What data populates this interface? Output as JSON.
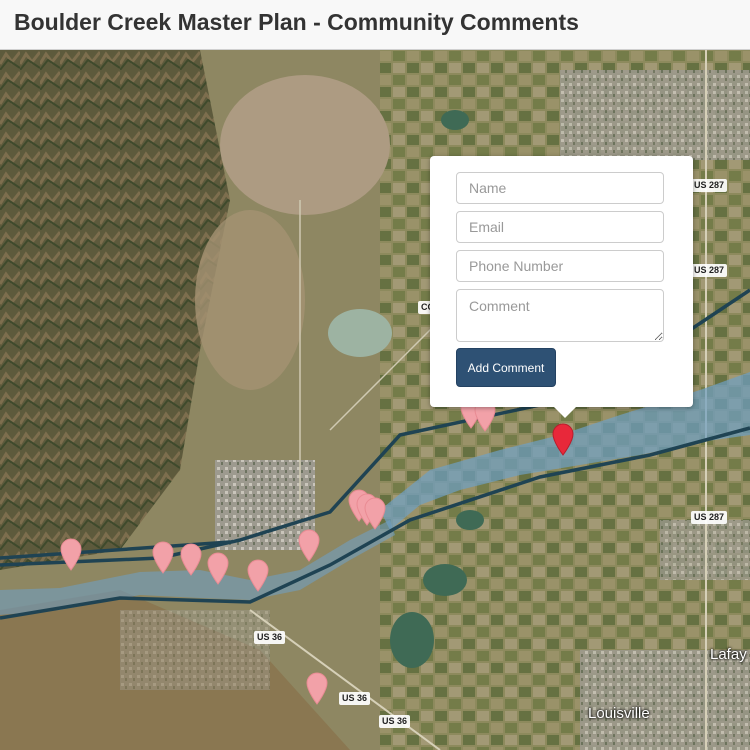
{
  "header": {
    "title": "Boulder Creek Master Plan - Community Comments"
  },
  "map": {
    "road_labels": [
      "US 287",
      "US 287",
      "US 287",
      "US 36",
      "US 36",
      "US 36",
      "CO"
    ],
    "town_labels": [
      "Louisville",
      "Lafay"
    ],
    "colors": {
      "marker": "#f2a1a8",
      "marker_active": "#e8283a",
      "boundary_line": "#1f4353",
      "floodplain": "#6f9fc2"
    }
  },
  "popup": {
    "name_placeholder": "Name",
    "email_placeholder": "Email",
    "phone_placeholder": "Phone Number",
    "comment_placeholder": "Comment",
    "submit_label": "Add Comment"
  }
}
